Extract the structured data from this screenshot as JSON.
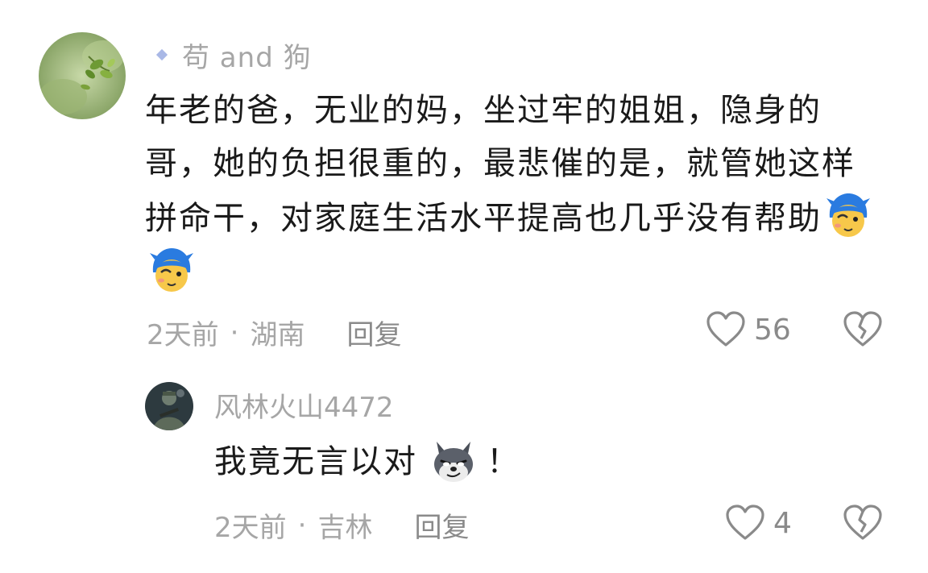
{
  "comment": {
    "username": "苟 and 狗",
    "text": "年老的爸，无业的妈，坐过牢的姐姐，隐身的哥，她的负担很重的，最悲催的是，就管她这样拼命干，对家庭生活水平提高也几乎没有帮助",
    "emojis": [
      "shy-face-emoji",
      "shy-face-emoji"
    ],
    "time": "2天前",
    "location": "湖南",
    "separator": "·",
    "reply_label": "回复",
    "likes": "56"
  },
  "reply": {
    "username": "风林火山4472",
    "text": "我竟无言以对",
    "emoji": "smirking-dog-emoji",
    "suffix": "！",
    "time": "2天前",
    "location": "吉林",
    "separator": "·",
    "reply_label": "回复",
    "likes": "4"
  },
  "colors": {
    "text": "#1a1a1a",
    "muted": "#a6a6a6",
    "icon": "#8a8a8a",
    "badge": "#a9b8e6"
  }
}
